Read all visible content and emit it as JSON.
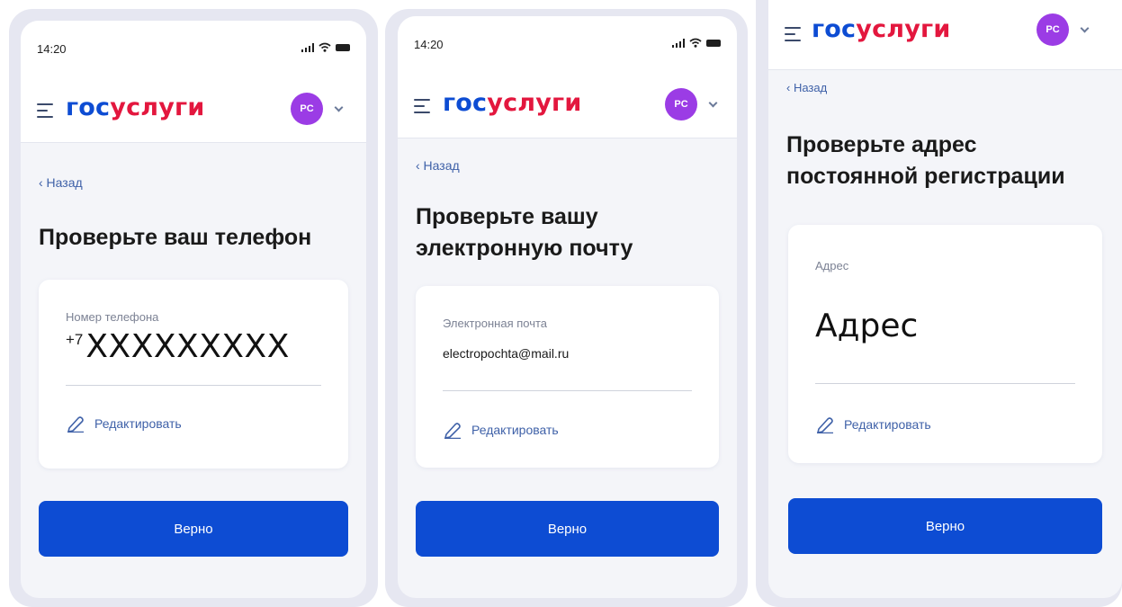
{
  "status": {
    "time": "14:20"
  },
  "header": {
    "logo_part1": "гос",
    "logo_part2": "услуги",
    "avatar_initials": "PC"
  },
  "brand_colors": {
    "blue": "#0d4cd3",
    "red": "#e3173e",
    "avatar": "#9b3ce5"
  },
  "back_label": "‹ Назад",
  "screens": [
    {
      "title": "Проверьте ваш телефон",
      "field_label": "Номер телефона",
      "prefix": "+7",
      "value": "XXXXXXXXX",
      "edit_label": "Редактировать",
      "confirm_label": "Верно"
    },
    {
      "title": "Проверьте вашу электронную почту",
      "field_label": "Электронная почта",
      "value": "electropochta@mail.ru",
      "edit_label": "Редактировать",
      "confirm_label": "Верно"
    },
    {
      "title": "Проверьте адрес постоянной регистрации",
      "field_label": "Адрес",
      "value": "Адрес",
      "edit_label": "Редактировать",
      "confirm_label": "Верно"
    }
  ],
  "icons": [
    "menu-icon",
    "chevron-down-icon",
    "signal-icon",
    "wifi-icon",
    "battery-icon",
    "pencil-icon"
  ]
}
